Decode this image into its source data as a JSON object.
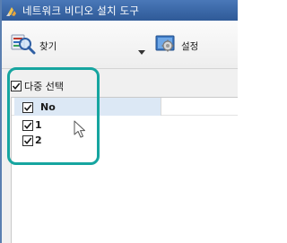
{
  "window": {
    "title": "네트워크 비디오 설치 도구"
  },
  "toolbar": {
    "find_label": "찾기",
    "settings_label": "설정"
  },
  "multi_select": {
    "label": "다중 선택",
    "checked": true
  },
  "list": {
    "header_label": "No",
    "rows": [
      {
        "label": "1",
        "checked": true
      },
      {
        "label": "2",
        "checked": true
      }
    ]
  },
  "colors": {
    "titlebar": "#3a67a6",
    "callout": "#16a5a0",
    "selection": "#dce8f5"
  }
}
